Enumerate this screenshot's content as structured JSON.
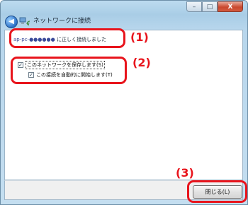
{
  "window": {
    "title": "ネットワークに接続",
    "caption_buttons": {
      "minimize": "–",
      "maximize": "□",
      "close": "X"
    }
  },
  "icons": {
    "back": "back-arrow-icon",
    "network": "network-icon"
  },
  "status": {
    "ssid_prefix": "ap-pc-",
    "ssid_masked": "●●●●●●",
    "message": " に正しく接続しました"
  },
  "options": {
    "save_network": {
      "label": "このネットワークを保存します(S)",
      "checked": true
    },
    "auto_connect": {
      "label": "この接続を自動的に開始します(T)",
      "checked": true
    }
  },
  "footer": {
    "close_label": "閉じる(L)"
  },
  "annotations": {
    "a1": "(1)",
    "a2": "(2)",
    "a3": "(3)"
  },
  "colors": {
    "annotation": "#e8141c",
    "frame": "#b7d6ec"
  }
}
